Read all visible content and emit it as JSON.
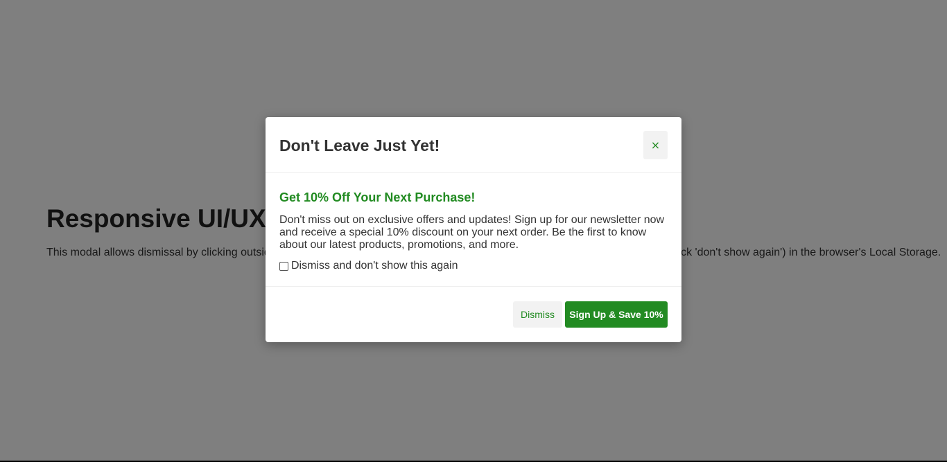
{
  "page": {
    "heading": "Responsive UI/UX",
    "description": "This modal allows dismissal by clicking outside, pressing Escape, or clicking the close button, and it saves your choice (if you check 'don't show again') in the browser's Local Storage."
  },
  "modal": {
    "title": "Don't Leave Just Yet!",
    "close_symbol": "×",
    "close_icon": "close-icon",
    "offer_title": "Get 10% Off Your Next Purchase!",
    "offer_text": "Don't miss out on exclusive offers and updates! Sign up for our newsletter now and receive a special 10% discount on your next order. Be the first to know about our latest products, promotions, and more.",
    "dont_show_label": "Dismiss and don't show this again",
    "dont_show_checked": false,
    "dismiss_label": "Dismiss",
    "signup_label": "Sign Up & Save 10%"
  },
  "colors": {
    "accent": "#228b22",
    "overlay": "rgba(0,0,0,0.5)",
    "button_secondary_bg": "#f2f2f2"
  }
}
